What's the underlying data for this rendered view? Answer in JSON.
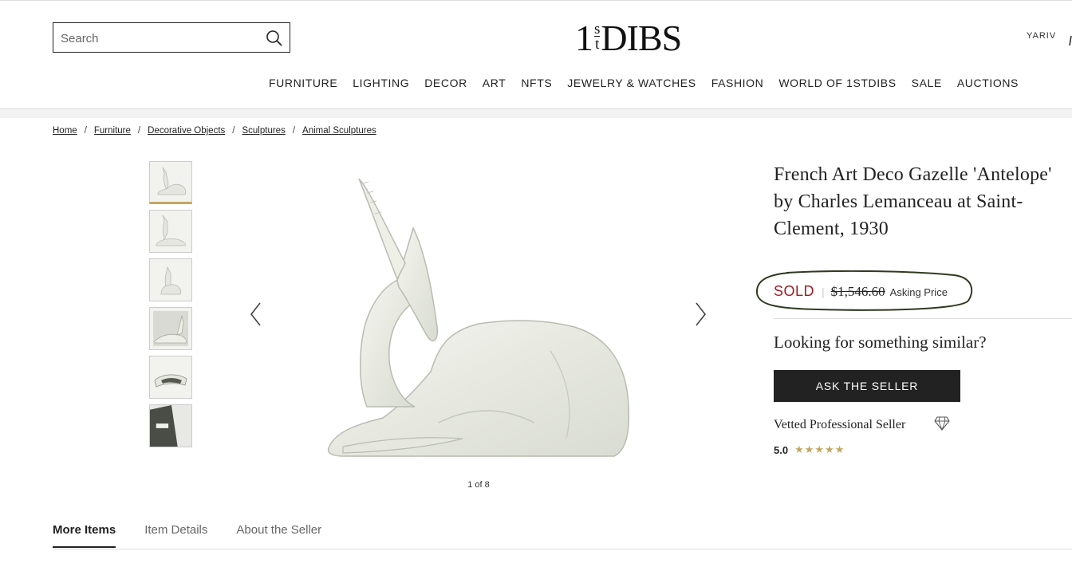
{
  "header": {
    "search": {
      "placeholder": "Search",
      "value": ""
    },
    "logo": {
      "one": "1",
      "st_top": "s",
      "st_bottom": "t",
      "dibs": "DIBS"
    },
    "user_name": "YARIV",
    "nav": [
      "FURNITURE",
      "LIGHTING",
      "DECOR",
      "ART",
      "NFTS",
      "JEWELRY & WATCHES",
      "FASHION",
      "WORLD OF 1STDIBS",
      "SALE",
      "AUCTIONS"
    ]
  },
  "breadcrumbs": [
    "Home",
    "Furniture",
    "Decorative Objects",
    "Sculptures",
    "Animal Sculptures"
  ],
  "gallery": {
    "counter": "1 of 8",
    "thumbnail_count": 6,
    "active_index": 0
  },
  "product": {
    "title": "French Art Deco Gazelle 'Antelope' by Charles Lemanceau at Saint-Clement, 1930",
    "status": "SOLD",
    "price": "$1,546.60",
    "price_label": "Asking Price",
    "similar_prompt": "Looking for something similar?",
    "ask_button": "ASK THE SELLER",
    "seller_badge": "Vetted Professional Seller",
    "rating": "5.0",
    "stars": 5
  },
  "tabs": [
    {
      "label": "More Items",
      "active": true
    },
    {
      "label": "Item Details",
      "active": false
    },
    {
      "label": "About the Seller",
      "active": false
    }
  ],
  "colors": {
    "sold": "#a01c23",
    "gold": "#c2a661",
    "annotation": "#2f3a1f",
    "button": "#222222"
  }
}
